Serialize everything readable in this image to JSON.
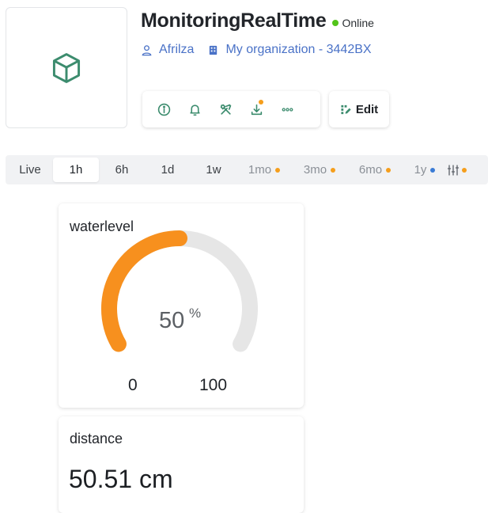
{
  "device": {
    "icon": "cube-icon",
    "icon_color": "#3c8c6e"
  },
  "header": {
    "title": "MonitoringRealTime",
    "status": {
      "label": "Online",
      "color": "#52c41a"
    },
    "owner": {
      "icon": "user-icon",
      "name": "Afrilza"
    },
    "organization": {
      "icon": "building-icon",
      "name": "My organization - 3442BX"
    }
  },
  "toolbar": {
    "items": [
      {
        "icon": "info-icon"
      },
      {
        "icon": "bell-icon"
      },
      {
        "icon": "tools-icon"
      },
      {
        "icon": "download-icon",
        "badge_color": "#f59e1c"
      },
      {
        "icon": "more-icon"
      }
    ],
    "edit_label": "Edit",
    "edit_icon": "edit-icon",
    "accent": "#3c8c6e"
  },
  "time_range": {
    "items": [
      {
        "label": "Live"
      },
      {
        "label": "1h",
        "active": true
      },
      {
        "label": "6h"
      },
      {
        "label": "1d"
      },
      {
        "label": "1w"
      },
      {
        "label": "1mo",
        "dot": "#f59e1c"
      },
      {
        "label": "3mo",
        "dot": "#f59e1c"
      },
      {
        "label": "6mo",
        "dot": "#f59e1c"
      },
      {
        "label": "1y",
        "dot": "#3a7bd5"
      }
    ],
    "settings_icon": "sliders-icon",
    "settings_dot": "#f59e1c"
  },
  "widgets": {
    "gauge": {
      "title": "waterlevel",
      "value": "50",
      "unit": "%",
      "min": "0",
      "max": "100",
      "fill_fraction": 0.5,
      "fill_color": "#f7901e",
      "track_color": "#e6e6e6"
    },
    "distance": {
      "title": "distance",
      "value": "50.51 cm"
    }
  }
}
